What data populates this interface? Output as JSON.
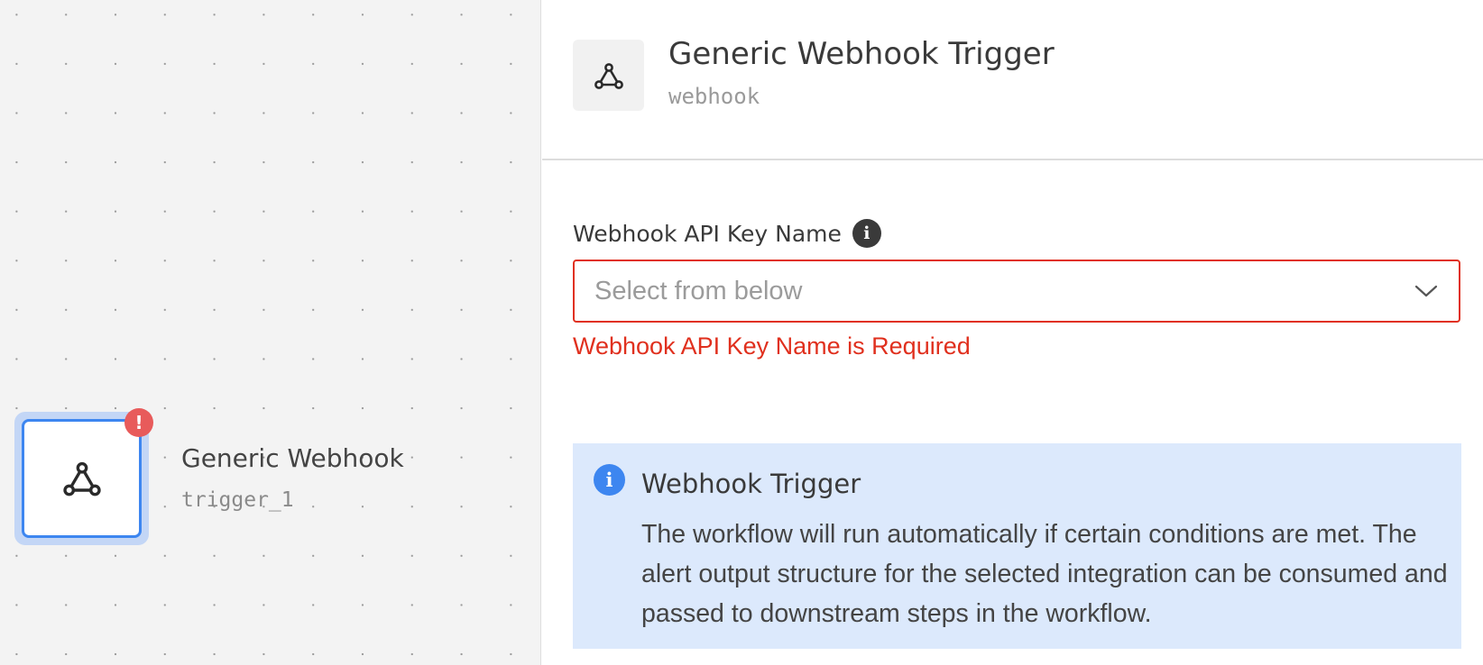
{
  "canvas": {
    "node": {
      "title": "Generic Webhook",
      "subtitle": "trigger_1",
      "error_badge": "!",
      "icon": "webhook-icon"
    }
  },
  "panel": {
    "header": {
      "icon": "webhook-icon",
      "title": "Generic Webhook Trigger",
      "subtitle": "webhook"
    },
    "field": {
      "label": "Webhook API Key Name",
      "info_icon": "i",
      "placeholder": "Select from below",
      "error": "Webhook API Key Name is Required"
    },
    "callout": {
      "icon": "i",
      "title": "Webhook Trigger",
      "text": "The workflow will run automatically if certain conditions are met. The alert output structure for the selected integration can be consumed and passed to downstream steps in the workflow."
    }
  },
  "colors": {
    "error": "#e0301e",
    "accent": "#3d86f0",
    "callout_bg": "#dce9fc"
  }
}
